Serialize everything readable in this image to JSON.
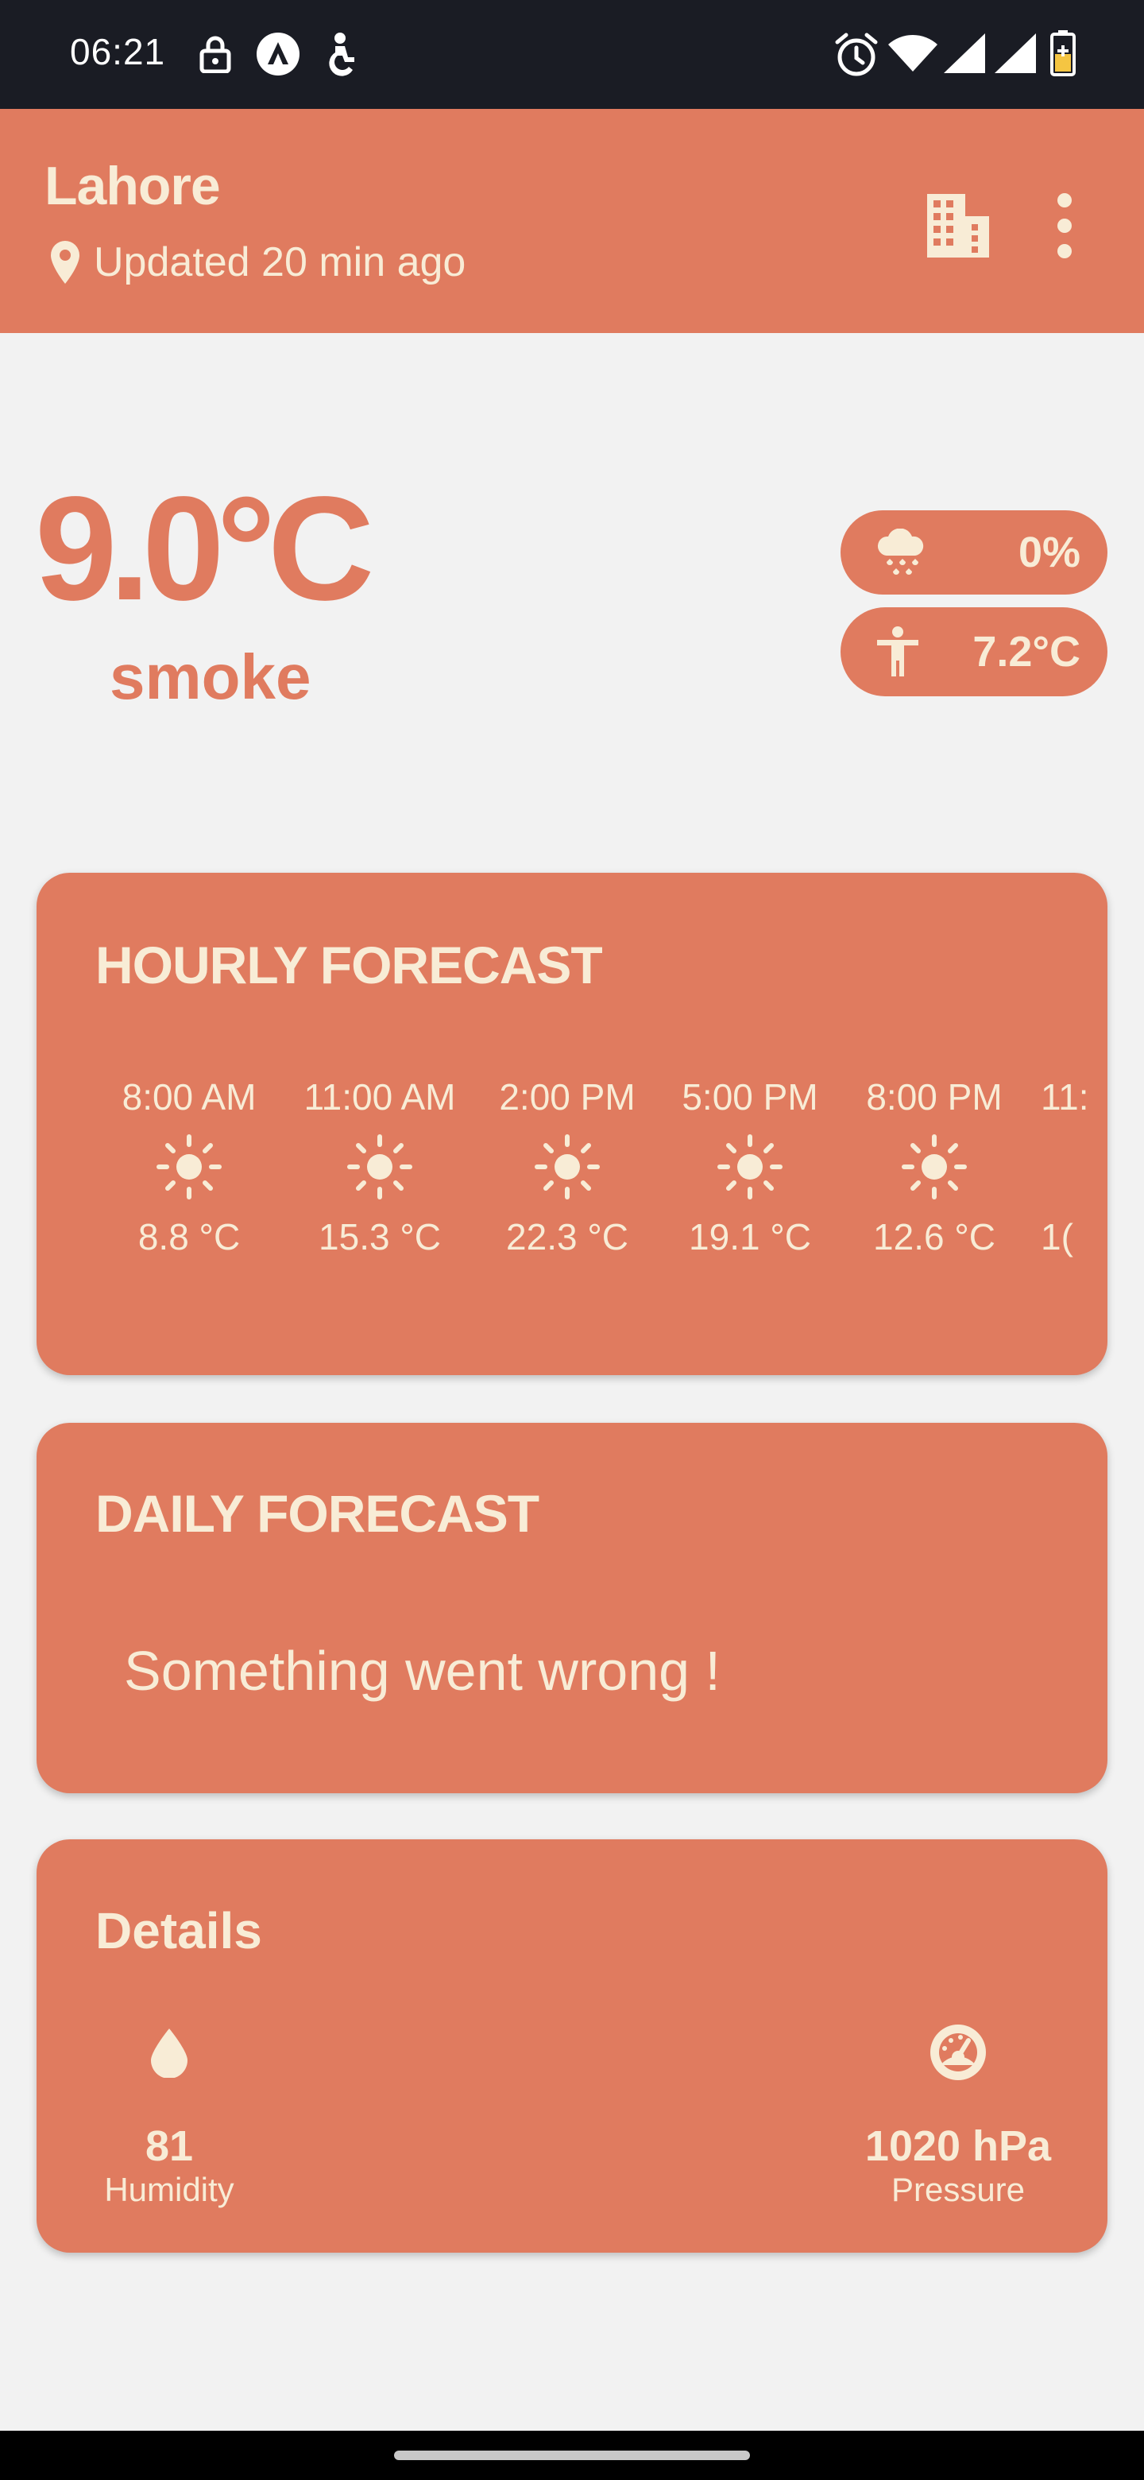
{
  "status_bar": {
    "time": "06:21",
    "left_icons": [
      "lock-icon",
      "app-a-icon",
      "accessibility-icon"
    ],
    "right_icons": [
      "alarm-icon",
      "wifi-icon",
      "signal-icon",
      "signal-icon",
      "battery-charging-icon"
    ]
  },
  "app_bar": {
    "city": "Lahore",
    "updated": "Updated 20 min ago",
    "icons": [
      "location-pin-icon",
      "city-buildings-icon",
      "more-vert-icon"
    ]
  },
  "current": {
    "temperature": "9.0°C",
    "condition": "smoke",
    "precipitation": {
      "icon": "cloud-rain-icon",
      "value": "0%"
    },
    "feels_like": {
      "icon": "person-icon",
      "value": "7.2°C"
    }
  },
  "hourly": {
    "title": "HOURLY FORECAST",
    "items": [
      {
        "time": "8:00 AM",
        "icon": "sun-icon",
        "temp": "8.8 °C"
      },
      {
        "time": "11:00 AM",
        "icon": "sun-icon",
        "temp": "15.3 °C"
      },
      {
        "time": "2:00 PM",
        "icon": "sun-icon",
        "temp": "22.3 °C"
      },
      {
        "time": "5:00 PM",
        "icon": "sun-icon",
        "temp": "19.1 °C"
      },
      {
        "time": "8:00 PM",
        "icon": "sun-icon",
        "temp": "12.6 °C"
      },
      {
        "time": "11:",
        "icon": "",
        "temp": "1("
      }
    ]
  },
  "daily": {
    "title": "DAILY FORECAST",
    "error": "Something went wrong !"
  },
  "details": {
    "title": "Details",
    "humidity": {
      "icon": "water-drop-icon",
      "value": "81",
      "label": "Humidity"
    },
    "pressure": {
      "icon": "gauge-icon",
      "value": "1020 hPa",
      "label": "Pressure"
    }
  },
  "colors": {
    "accent": "#e07b5f",
    "on_accent": "#f8ecd6",
    "background": "#f2f2f2",
    "status_bar": "#1a1c24"
  }
}
